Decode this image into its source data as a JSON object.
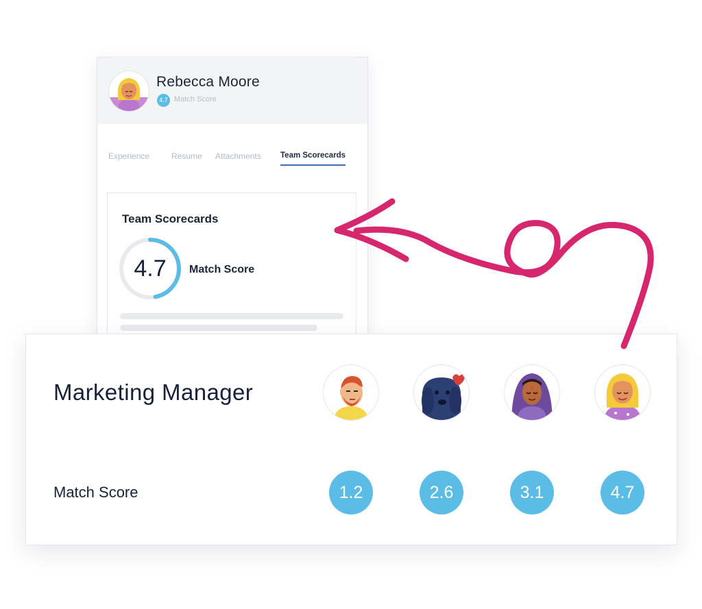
{
  "profile": {
    "name": "Rebecca Moore",
    "score": "4.7",
    "score_label": "Match Score",
    "tabs": [
      {
        "label": "Experience",
        "active": false
      },
      {
        "label": "Resume",
        "active": false
      },
      {
        "label": "Attachments",
        "active": false
      },
      {
        "label": "Team Scorecards",
        "active": true
      }
    ],
    "scorecard": {
      "title": "Team Scorecards",
      "score": "4.7",
      "score_label": "Match Score",
      "score_max": 5
    }
  },
  "comparison": {
    "job_title": "Marketing Manager",
    "row_label": "Match Score",
    "reviewers": [
      {
        "avatar": "man-beard-avatar",
        "score": "1.2"
      },
      {
        "avatar": "dog-avatar",
        "score": "2.6"
      },
      {
        "avatar": "woman-headscarf-avatar",
        "score": "3.1"
      },
      {
        "avatar": "woman-blonde-avatar",
        "score": "4.7"
      }
    ]
  },
  "colors": {
    "accent": "#5bbde6",
    "tab_underline": "#3a6fb5",
    "arrow": "#d6276e",
    "header_bg": "#f3f4f6"
  },
  "icons": {
    "arrow": "hand-drawn-arrow-icon"
  }
}
